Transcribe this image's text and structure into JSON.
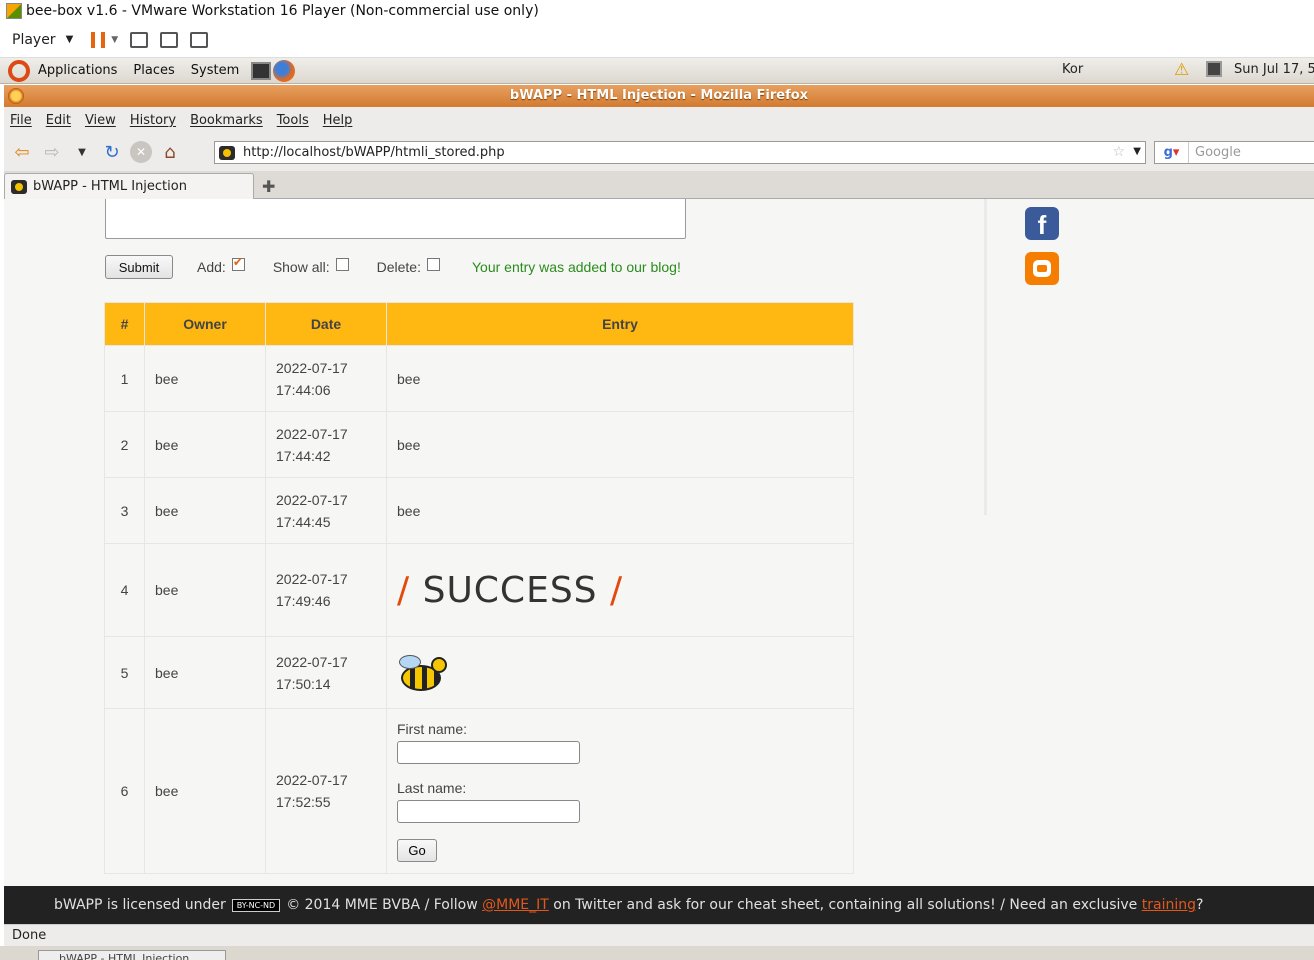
{
  "vm": {
    "title": "bee-box v1.6 - VMware Workstation 16 Player (Non-commercial use only)",
    "player_label": "Player"
  },
  "panel": {
    "applications": "Applications",
    "places": "Places",
    "system": "System",
    "keyboard": "Kor",
    "clock": "Sun Jul 17,  5"
  },
  "firefox": {
    "window_title": "bWAPP - HTML Injection - Mozilla Firefox",
    "menu": [
      "File",
      "Edit",
      "View",
      "History",
      "Bookmarks",
      "Tools",
      "Help"
    ],
    "url": "http://localhost/bWAPP/htmli_stored.php",
    "search_placeholder": "Google",
    "tab_title": "bWAPP - HTML Injection",
    "status": "Done"
  },
  "form": {
    "submit_label": "Submit",
    "add_label": "Add:",
    "add_checked": true,
    "show_all_label": "Show all:",
    "show_all_checked": false,
    "delete_label": "Delete:",
    "delete_checked": false,
    "message": "Your entry was added to our blog!"
  },
  "table": {
    "headers": [
      "#",
      "Owner",
      "Date",
      "Entry"
    ],
    "rows": [
      {
        "num": "1",
        "owner": "bee",
        "date": "2022-07-17",
        "time": "17:44:06",
        "entry": "bee"
      },
      {
        "num": "2",
        "owner": "bee",
        "date": "2022-07-17",
        "time": "17:44:42",
        "entry": "bee"
      },
      {
        "num": "3",
        "owner": "bee",
        "date": "2022-07-17",
        "time": "17:44:45",
        "entry": "bee"
      },
      {
        "num": "4",
        "owner": "bee",
        "date": "2022-07-17",
        "time": "17:49:46",
        "entry_graphic": "SUCCESS"
      },
      {
        "num": "5",
        "owner": "bee",
        "date": "2022-07-17",
        "time": "17:50:14",
        "entry_icon": "bee-icon"
      },
      {
        "num": "6",
        "owner": "bee",
        "date": "2022-07-17",
        "time": "17:52:55",
        "entry_form": {
          "first_name_label": "First name:",
          "last_name_label": "Last name:",
          "go_label": "Go"
        }
      }
    ]
  },
  "sidebar": {
    "icons": [
      "facebook-icon",
      "blogger-icon"
    ],
    "facebook_letter": "f"
  },
  "footer": {
    "part1": "bWAPP is licensed under",
    "cc_badge": "BY-NC-ND",
    "part2": "© 2014 MME BVBA / Follow",
    "twitter_link": "@MME_IT",
    "part3": "on Twitter and ask for our cheat sheet, containing all solutions! / Need an exclusive",
    "training_link": "training",
    "part4": "?"
  },
  "taskbar": {
    "item": "bWAPP - HTML Injection"
  }
}
